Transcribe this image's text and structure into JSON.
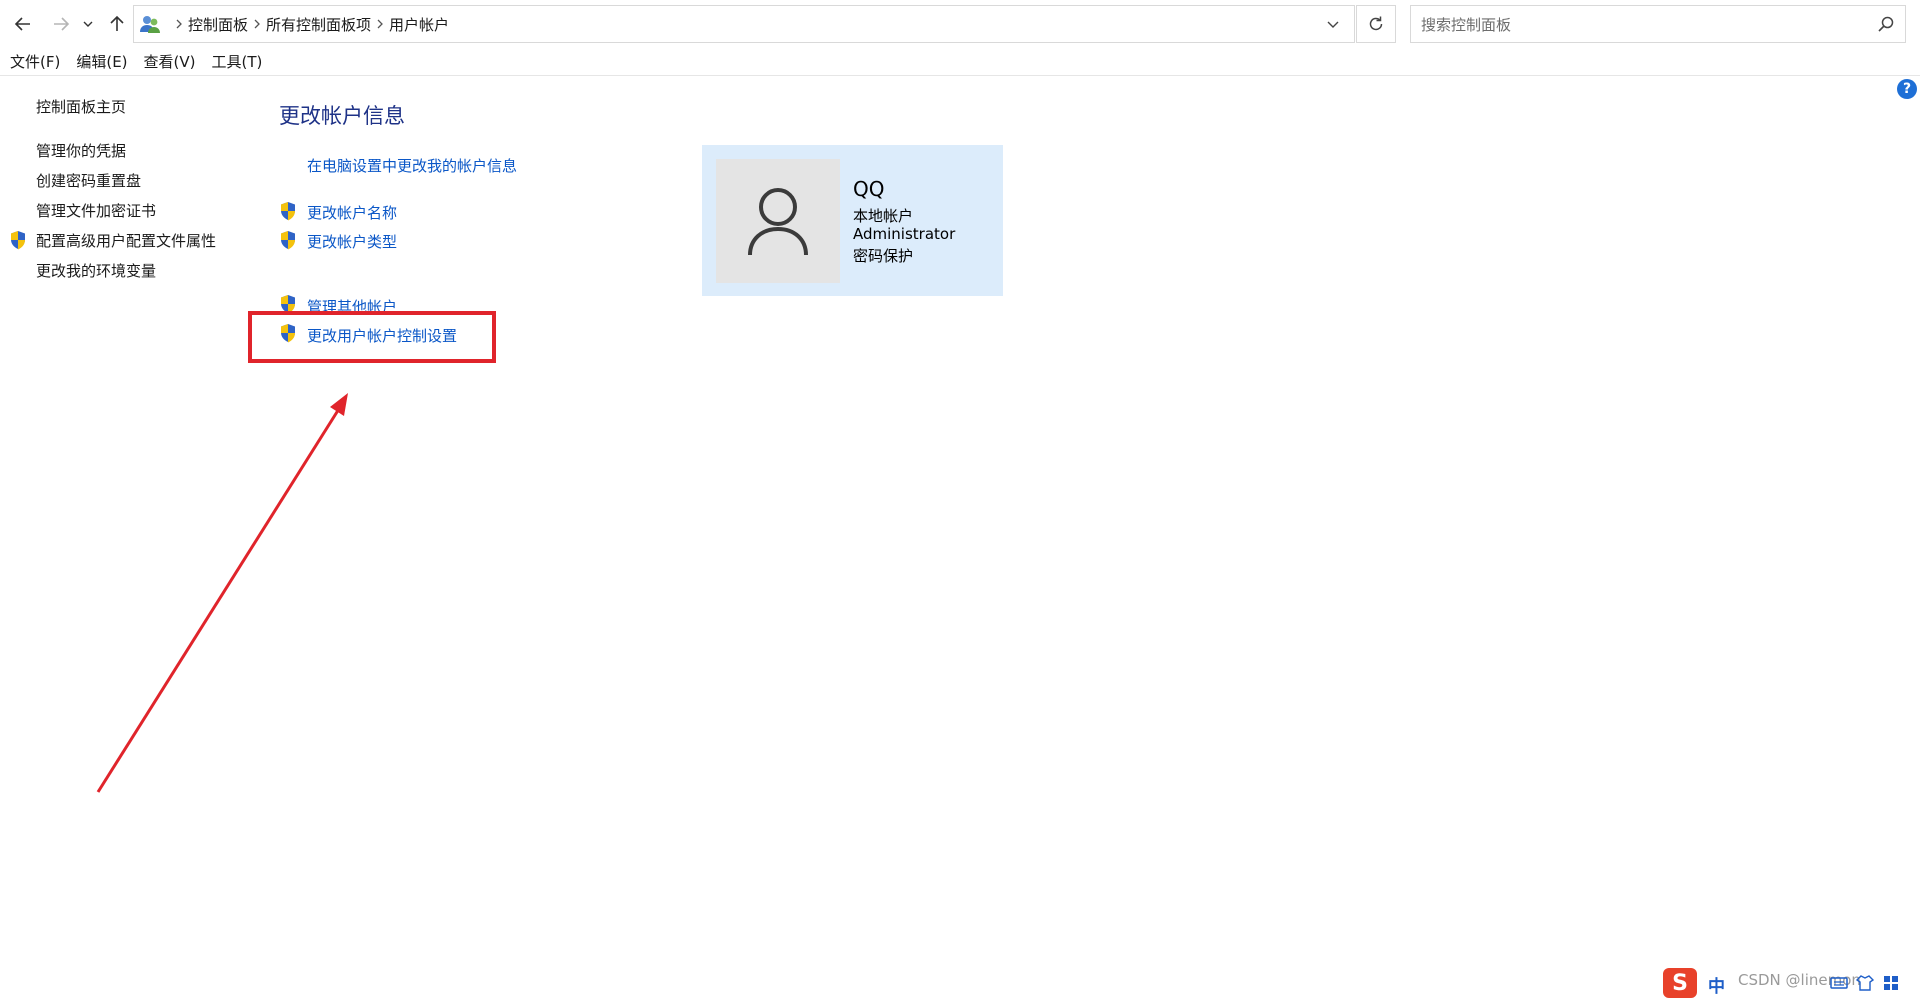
{
  "breadcrumb": [
    "控制面板",
    "所有控制面板项",
    "用户帐户"
  ],
  "search": {
    "placeholder": "搜索控制面板"
  },
  "menu": [
    "文件(F)",
    "编辑(E)",
    "查看(V)",
    "工具(T)"
  ],
  "help": {
    "label": "?"
  },
  "left_pane": {
    "home": "控制面板主页",
    "links": [
      "管理你的凭据",
      "创建密码重置盘",
      "管理文件加密证书",
      "配置高级用户配置文件属性",
      "更改我的环境变量"
    ]
  },
  "main": {
    "title": "更改帐户信息",
    "pc_settings_link": "在电脑设置中更改我的帐户信息",
    "tasks": [
      "更改帐户名称",
      "更改帐户类型",
      "管理其他帐户",
      "更改用户帐户控制设置"
    ]
  },
  "account": {
    "name": "QQ",
    "type": "本地帐户",
    "role": "Administrator",
    "protection": "密码保护"
  },
  "tray": {
    "ime_logo": "S",
    "ime_lang": "中",
    "watermark": "CSDN @linemon"
  },
  "colors": {
    "link": "#0b57c7",
    "title": "#1e3287",
    "highlight": "#e0242b",
    "tile": "#dcecfb"
  }
}
